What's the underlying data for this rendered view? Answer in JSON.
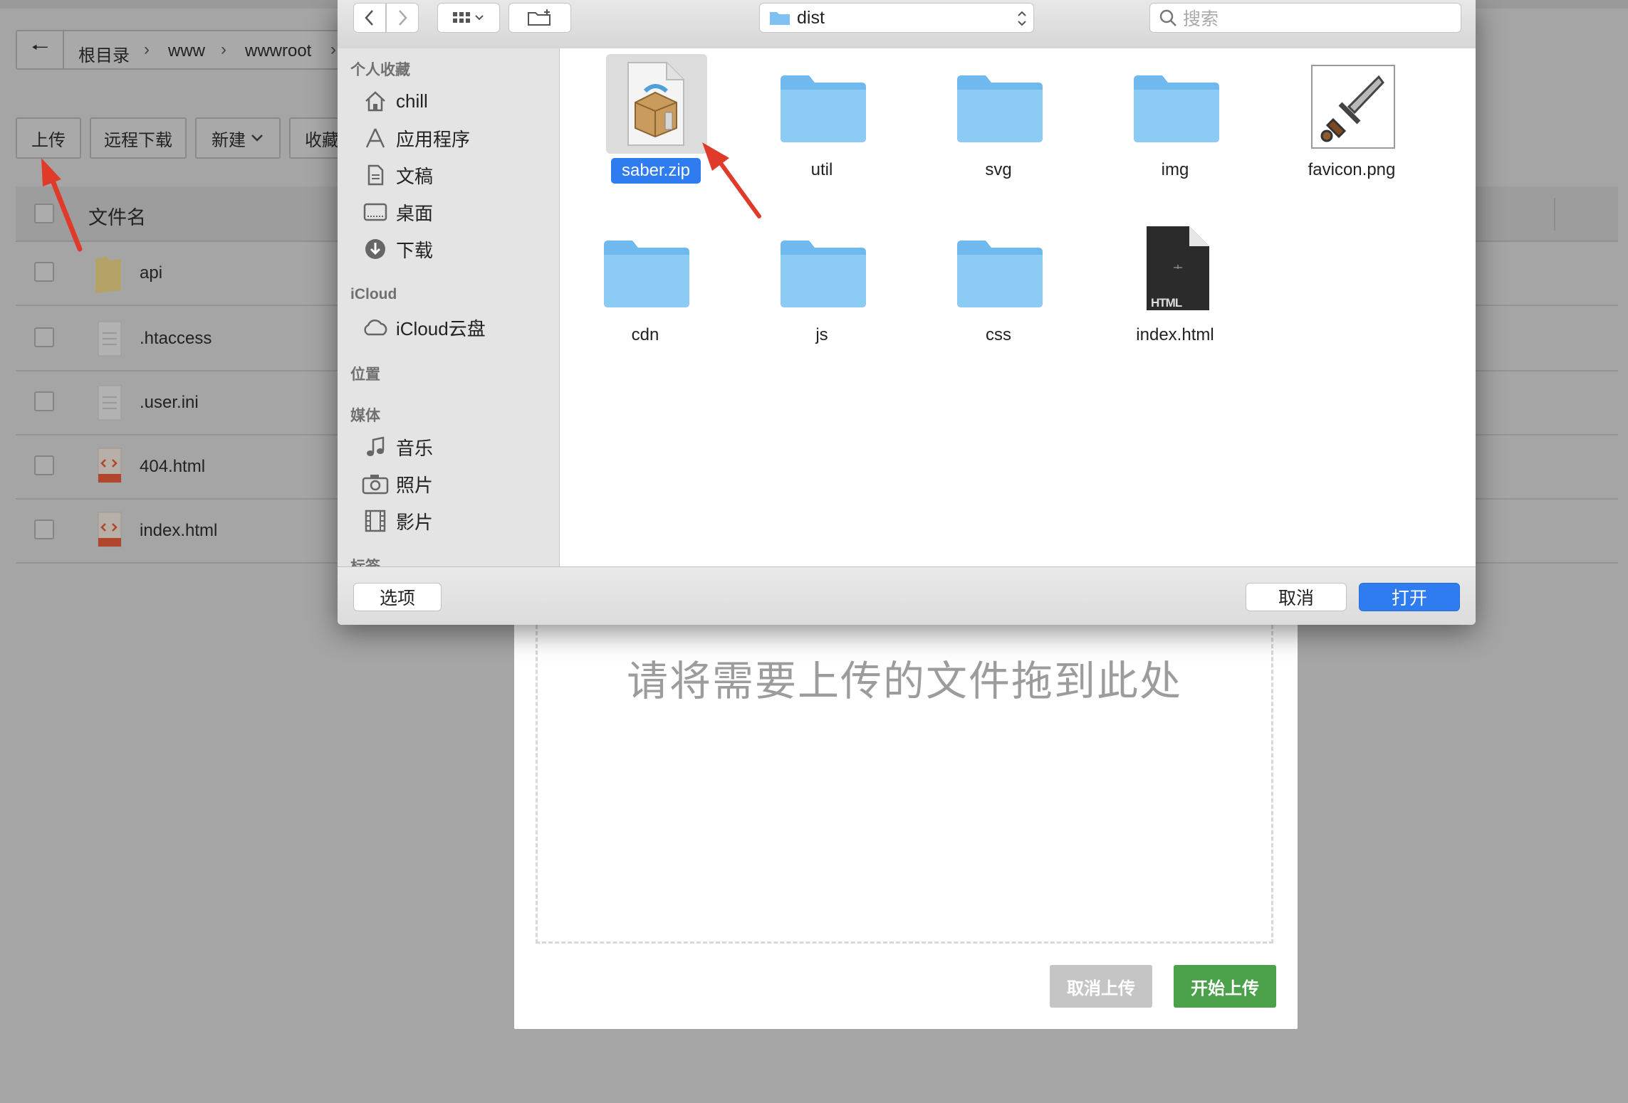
{
  "background_page": {
    "breadcrumb": [
      "根目录",
      "www",
      "wwwroot"
    ],
    "toolbar": {
      "upload": "上传",
      "remote_download": "远程下载",
      "new": "新建",
      "favorites": "收藏"
    },
    "table_header": {
      "filename": "文件名"
    },
    "files": [
      {
        "name": "api",
        "type": "folder"
      },
      {
        "name": ".htaccess",
        "type": "file"
      },
      {
        "name": ".user.ini",
        "type": "file"
      },
      {
        "name": "404.html",
        "type": "html"
      },
      {
        "name": "index.html",
        "type": "html"
      }
    ]
  },
  "upload_modal": {
    "drop_hint": "请将需要上传的文件拖到此处",
    "cancel_label": "取消上传",
    "start_label": "开始上传",
    "colors": {
      "start": "#4aa14a",
      "cancel": "#c5c5c5"
    }
  },
  "file_dialog": {
    "path": "dist",
    "search_placeholder": "搜索",
    "sidebar": {
      "favorites_title": "个人收藏",
      "favorites": [
        {
          "label": "chill",
          "icon": "home-icon"
        },
        {
          "label": "应用程序",
          "icon": "applications-icon"
        },
        {
          "label": "文稿",
          "icon": "document-icon"
        },
        {
          "label": "桌面",
          "icon": "desktop-icon"
        },
        {
          "label": "下载",
          "icon": "download-icon"
        }
      ],
      "icloud_title": "iCloud",
      "icloud": [
        {
          "label": "iCloud云盘",
          "icon": "cloud-icon"
        }
      ],
      "locations_title": "位置",
      "media_title": "媒体",
      "media": [
        {
          "label": "音乐",
          "icon": "music-icon"
        },
        {
          "label": "照片",
          "icon": "camera-icon"
        },
        {
          "label": "影片",
          "icon": "film-icon"
        }
      ],
      "tags_title": "标签"
    },
    "items": [
      {
        "name": "saber.zip",
        "kind": "archive",
        "selected": true
      },
      {
        "name": "util",
        "kind": "folder"
      },
      {
        "name": "svg",
        "kind": "folder"
      },
      {
        "name": "img",
        "kind": "folder"
      },
      {
        "name": "favicon.png",
        "kind": "image"
      },
      {
        "name": "cdn",
        "kind": "folder"
      },
      {
        "name": "js",
        "kind": "folder"
      },
      {
        "name": "css",
        "kind": "folder"
      },
      {
        "name": "index.html",
        "kind": "html",
        "badge": "HTML"
      }
    ],
    "options_label": "选项",
    "cancel_label": "取消",
    "open_label": "打开",
    "colors": {
      "accent": "#2f7bf0",
      "folder": "#8ccbf4"
    }
  }
}
